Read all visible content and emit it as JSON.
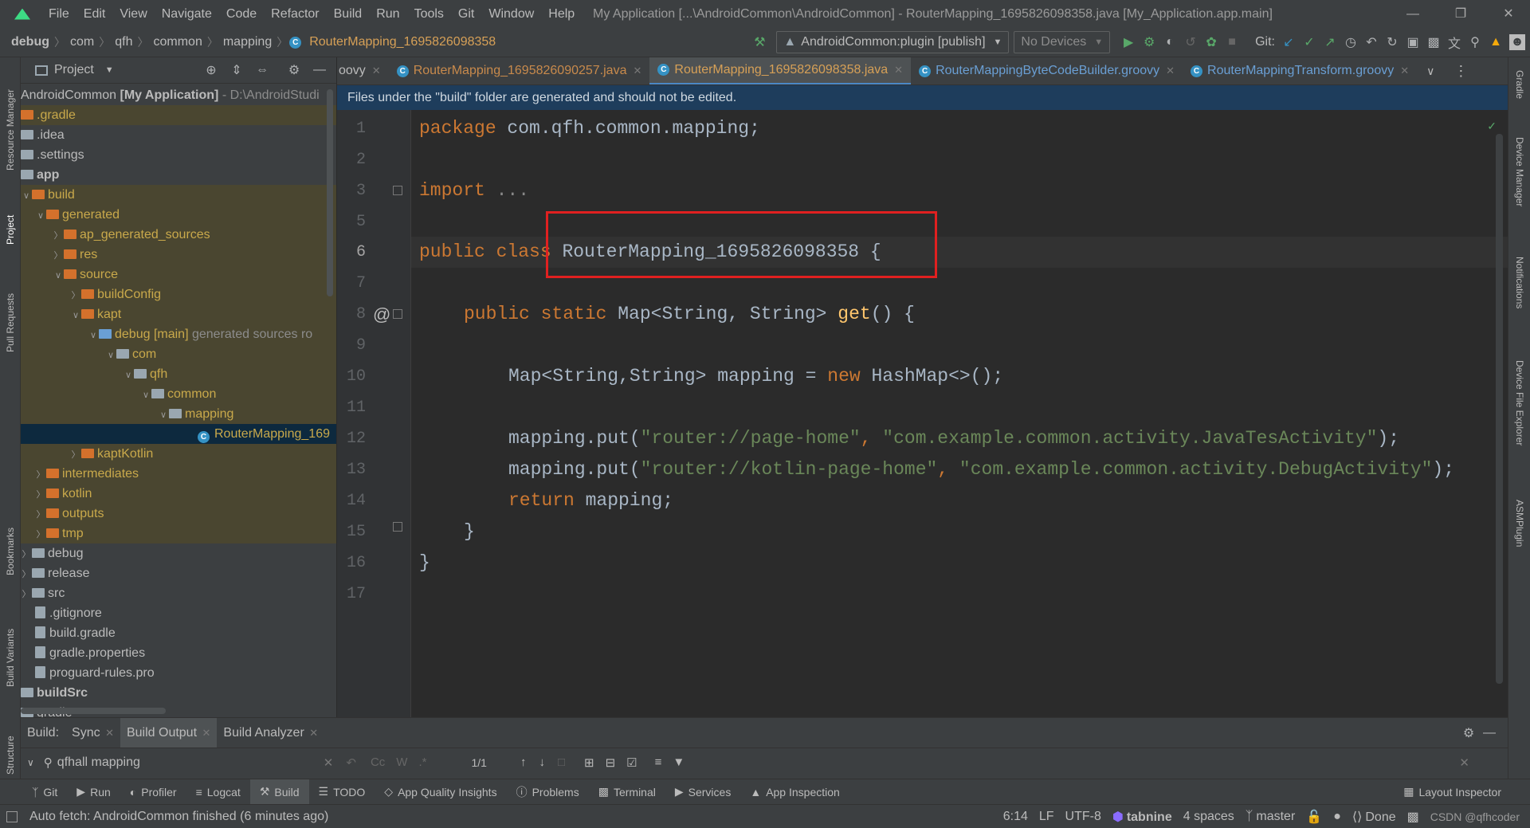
{
  "menubar": {
    "items": [
      "File",
      "Edit",
      "View",
      "Navigate",
      "Code",
      "Refactor",
      "Build",
      "Run",
      "Tools",
      "Git",
      "Window",
      "Help"
    ],
    "title": "My Application [...\\AndroidCommon\\AndroidCommon] - RouterMapping_1695826098358.java [My_Application.app.main]"
  },
  "navbar": {
    "crumbs": [
      "debug",
      "com",
      "qfh",
      "common",
      "mapping",
      "RouterMapping_1695826098358"
    ],
    "run_config": "AndroidCommon:plugin [publish]",
    "device": "No Devices",
    "git_label": "Git:"
  },
  "sidebar_left": {
    "resource_manager": "Resource Manager",
    "project": "Project",
    "pull_requests": "Pull Requests",
    "bookmarks": "Bookmarks",
    "build_variants": "Build Variants",
    "structure": "Structure"
  },
  "sidebar_right": {
    "gradle": "Gradle",
    "device_manager": "Device Manager",
    "notifications": "Notifications",
    "device_file_explorer": "Device File Explorer",
    "asmplugin": "ASMPlugin"
  },
  "project": {
    "header": "Project",
    "root_name": "AndroidCommon",
    "root_module": "[My Application]",
    "root_path": "- D:\\AndroidStudi",
    "tree": [
      {
        "label": ".gradle"
      },
      {
        "label": ".idea"
      },
      {
        "label": ".settings"
      },
      {
        "label": "app"
      },
      {
        "label": "build"
      },
      {
        "label": "generated"
      },
      {
        "label": "ap_generated_sources"
      },
      {
        "label": "res"
      },
      {
        "label": "source"
      },
      {
        "label": "buildConfig"
      },
      {
        "label": "kapt"
      },
      {
        "label": "debug [main]",
        "extra": "generated sources ro"
      },
      {
        "label": "com"
      },
      {
        "label": "qfh"
      },
      {
        "label": "common"
      },
      {
        "label": "mapping"
      },
      {
        "label": "RouterMapping_169"
      },
      {
        "label": "kaptKotlin"
      },
      {
        "label": "intermediates"
      },
      {
        "label": "kotlin"
      },
      {
        "label": "outputs"
      },
      {
        "label": "tmp"
      },
      {
        "label": "debug"
      },
      {
        "label": "release"
      },
      {
        "label": "src"
      },
      {
        "label": ".gitignore"
      },
      {
        "label": "build.gradle"
      },
      {
        "label": "gradle.properties"
      },
      {
        "label": "proguard-rules.pro"
      },
      {
        "label": "buildSrc"
      },
      {
        "label": "gradle"
      }
    ]
  },
  "tabs": [
    {
      "label": "oovy"
    },
    {
      "label": "RouterMapping_1695826090257.java"
    },
    {
      "label": "RouterMapping_1695826098358.java"
    },
    {
      "label": "RouterMappingByteCodeBuilder.groovy"
    },
    {
      "label": "RouterMappingTransform.groovy"
    }
  ],
  "banner": "Files under the \"build\" folder are generated and should not be edited.",
  "code": {
    "line_numbers": [
      "1",
      "2",
      "3",
      "5",
      "6",
      "7",
      "8",
      "9",
      "10",
      "11",
      "12",
      "13",
      "14",
      "15",
      "16",
      "17"
    ],
    "l1_kw": "package",
    "l1_rest": " com.qfh.common.mapping;",
    "l3_kw": "import",
    "l3_rest": " ...",
    "l6_kw": "public class",
    "l6_name": " RouterMapping_1695826098358",
    "l6_rest": " {",
    "l8_kw": "public static",
    "l8_type": " Map<String, String> ",
    "l8_fn": "get",
    "l8_rest": "() {",
    "l10_a": "Map<String,String> mapping = ",
    "l10_kw": "new",
    "l10_b": " HashMap<>();",
    "l12_a": "mapping.put(",
    "l12_s1": "\"router://page-home\"",
    "l12_c": ", ",
    "l12_s2": "\"com.example.common.activity.JavaTesActivity\"",
    "l12_e": ");",
    "l13_a": "mapping.put(",
    "l13_s1": "\"router://kotlin-page-home\"",
    "l13_c": ", ",
    "l13_s2": "\"com.example.common.activity.DebugActivity\"",
    "l13_e": ");",
    "l14_kw": "return",
    "l14_rest": " mapping;",
    "l15": "}",
    "l16": "}",
    "at_marker": "@"
  },
  "build_panel": {
    "label": "Build:",
    "tabs": [
      "Sync",
      "Build Output",
      "Build Analyzer"
    ],
    "search_value": "qfhall mapping",
    "match_count": "1/1",
    "case_btn": "Cc",
    "word_btn": "W",
    "regex_btn": ".*"
  },
  "toolwindows": [
    "Git",
    "Run",
    "Profiler",
    "Logcat",
    "Build",
    "TODO",
    "App Quality Insights",
    "Problems",
    "Terminal",
    "Services",
    "App Inspection"
  ],
  "layout_inspector": "Layout Inspector",
  "status": {
    "message": "Auto fetch: AndroidCommon finished (6 minutes ago)",
    "position": "6:14",
    "line_sep": "LF",
    "encoding": "UTF-8",
    "tabnine": "tabnine",
    "indent": "4 spaces",
    "branch": "master",
    "done": "Done",
    "watermark": "CSDN @qfhcoder"
  },
  "colors": {
    "accent": "#4a88c7",
    "keyword": "#cc7832",
    "string": "#6a8759",
    "function": "#ffc66d",
    "highlight_box": "#e02020"
  }
}
